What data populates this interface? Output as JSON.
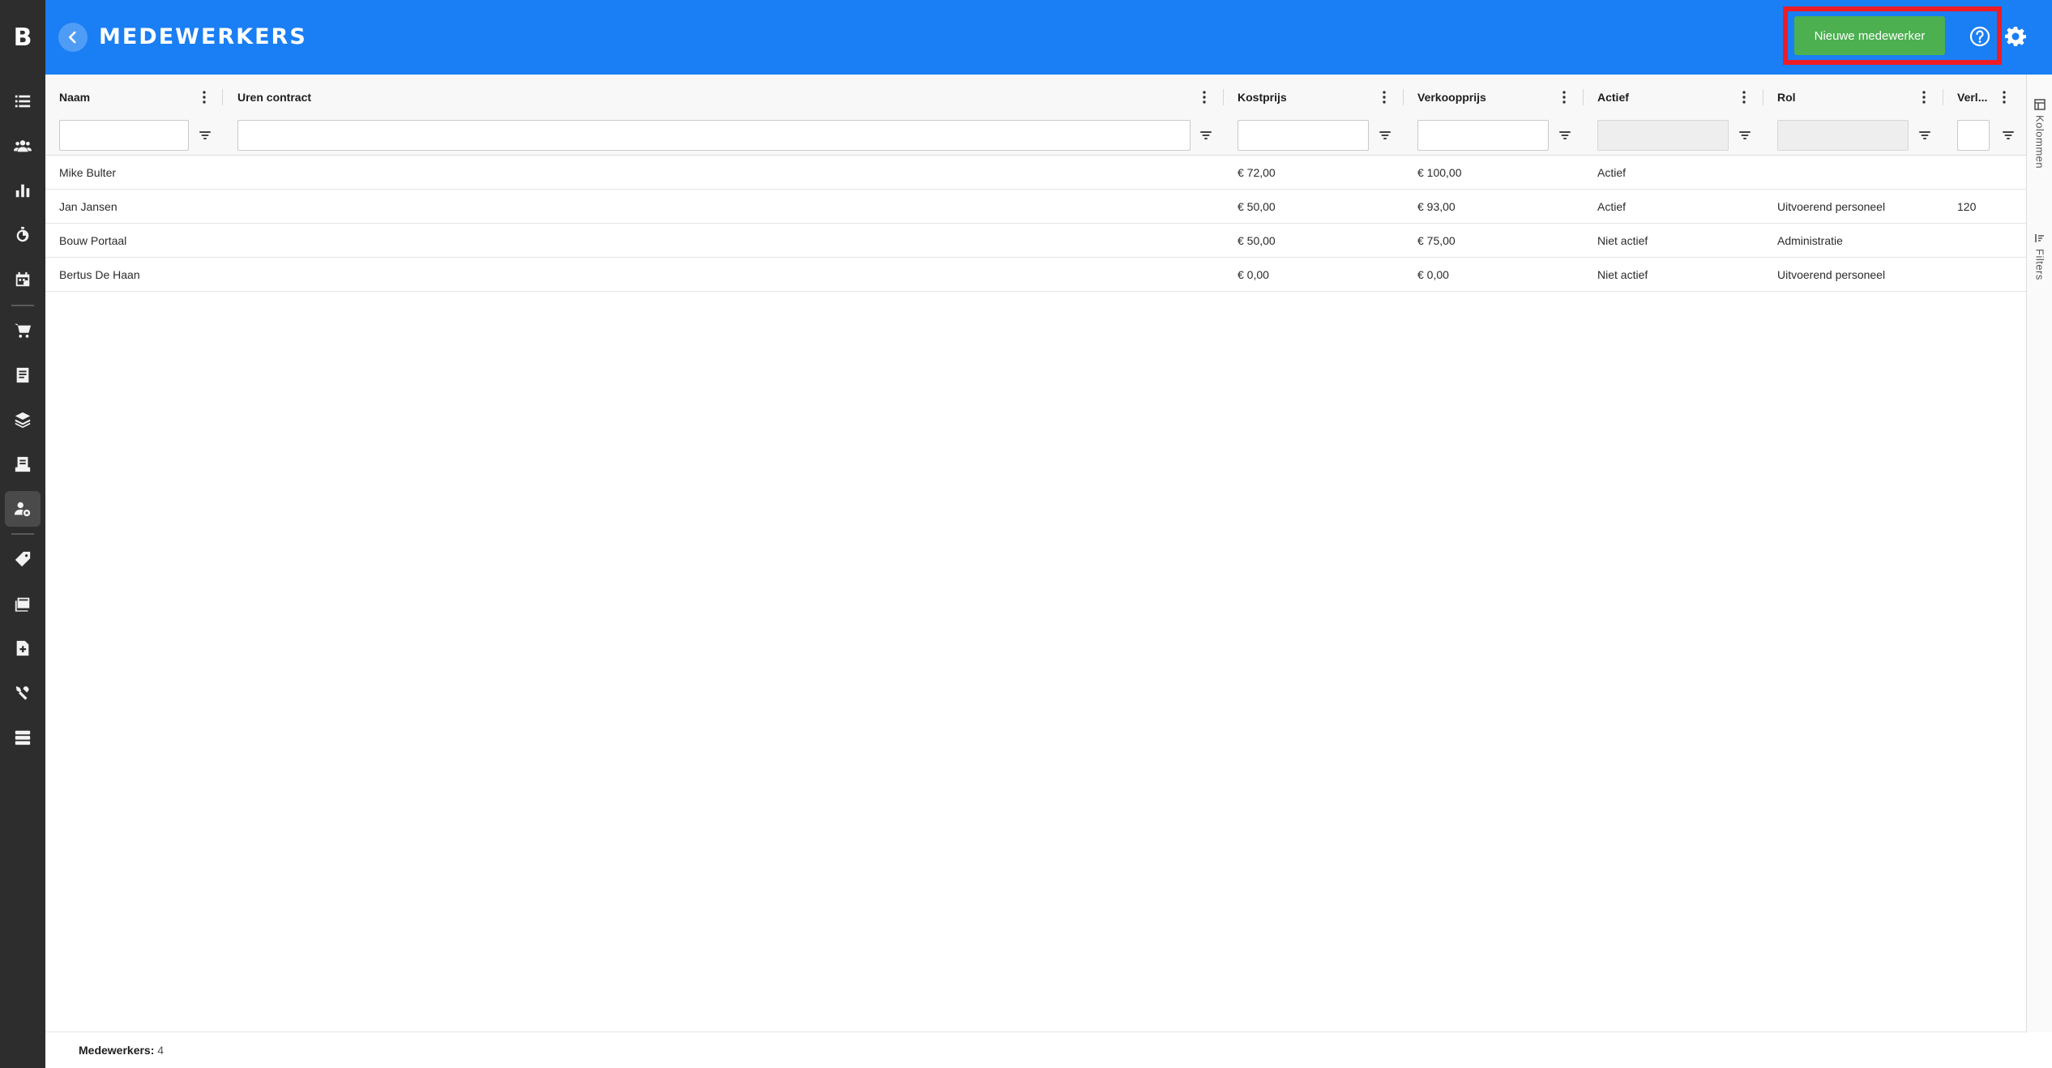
{
  "app": {
    "logo": "B",
    "title": "MEDEWERKERS",
    "new_button": "Nieuwe medewerker",
    "colors": {
      "header": "#1a7ef4",
      "sidebar": "#2d2d2d",
      "primary_button": "#4caf50",
      "highlight": "#ee1c24"
    }
  },
  "sidebar": {
    "items": [
      {
        "icon": "list-icon"
      },
      {
        "icon": "users-icon"
      },
      {
        "icon": "bar-chart-icon"
      },
      {
        "icon": "stopwatch-icon"
      },
      {
        "icon": "calendar-icon"
      },
      {
        "icon": "cart-icon"
      },
      {
        "icon": "document-icon"
      },
      {
        "icon": "layers-icon"
      },
      {
        "icon": "invoice-icon"
      },
      {
        "icon": "user-settings-icon",
        "active": true
      },
      {
        "icon": "tag-icon"
      },
      {
        "icon": "folders-icon"
      },
      {
        "icon": "file-plus-icon"
      },
      {
        "icon": "tools-icon"
      },
      {
        "icon": "server-icon"
      }
    ]
  },
  "grid": {
    "columns": [
      {
        "label": "Naam"
      },
      {
        "label": "Uren contract"
      },
      {
        "label": "Kostprijs"
      },
      {
        "label": "Verkoopprijs"
      },
      {
        "label": "Actief"
      },
      {
        "label": "Rol"
      },
      {
        "label": "Verl..."
      }
    ],
    "rows": [
      {
        "naam": "Mike Bulter",
        "uren": "",
        "kostprijs": "€ 72,00",
        "verkoopprijs": "€ 100,00",
        "actief": "Actief",
        "rol": "",
        "verl": ""
      },
      {
        "naam": "Jan Jansen",
        "uren": "",
        "kostprijs": "€ 50,00",
        "verkoopprijs": "€ 93,00",
        "actief": "Actief",
        "rol": "Uitvoerend personeel",
        "verl": "120"
      },
      {
        "naam": "Bouw Portaal",
        "uren": "",
        "kostprijs": "€ 50,00",
        "verkoopprijs": "€ 75,00",
        "actief": "Niet actief",
        "rol": "Administratie",
        "verl": ""
      },
      {
        "naam": "Bertus De Haan",
        "uren": "",
        "kostprijs": "€ 0,00",
        "verkoopprijs": "€ 0,00",
        "actief": "Niet actief",
        "rol": "Uitvoerend personeel",
        "verl": ""
      }
    ]
  },
  "tool_panel": {
    "columns_label": "Kolommen",
    "filters_label": "Filters"
  },
  "footer": {
    "label": "Medewerkers:",
    "count": "4"
  }
}
